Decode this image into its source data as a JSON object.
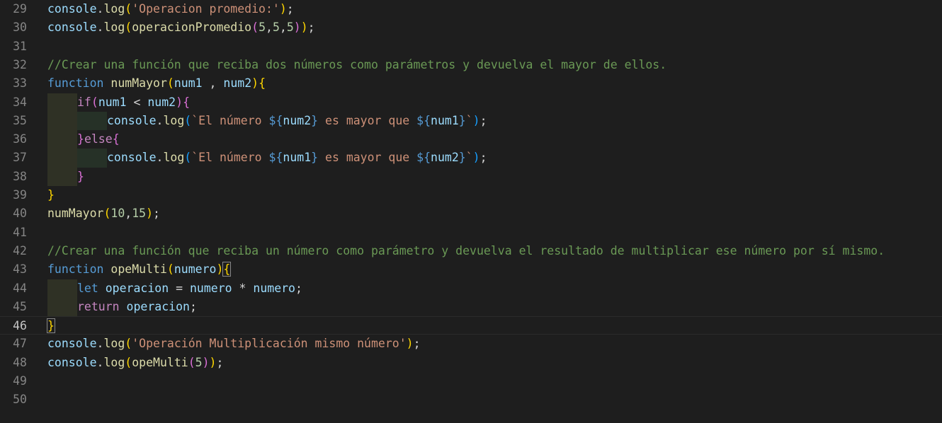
{
  "editor": {
    "lines": [
      {
        "n": "29",
        "tokens": [
          [
            "t-id",
            "console"
          ],
          [
            "t-p",
            "."
          ],
          [
            "t-fn",
            "log"
          ],
          [
            "b1",
            "("
          ],
          [
            "t-str",
            "'Operacion promedio:'"
          ],
          [
            "b1",
            ")"
          ],
          [
            "t-p",
            ";"
          ]
        ]
      },
      {
        "n": "30",
        "tokens": [
          [
            "t-id",
            "console"
          ],
          [
            "t-p",
            "."
          ],
          [
            "t-fn",
            "log"
          ],
          [
            "b1",
            "("
          ],
          [
            "t-fn",
            "operacionPromedio"
          ],
          [
            "b2",
            "("
          ],
          [
            "t-num",
            "5"
          ],
          [
            "t-p",
            ","
          ],
          [
            "t-num",
            "5"
          ],
          [
            "t-p",
            ","
          ],
          [
            "t-num",
            "5"
          ],
          [
            "b2",
            ")"
          ],
          [
            "b1",
            ")"
          ],
          [
            "t-p",
            ";"
          ]
        ]
      },
      {
        "n": "31",
        "tokens": []
      },
      {
        "n": "32",
        "tokens": [
          [
            "t-cm",
            "//Crear una función que reciba dos números como parámetros y devuelva el mayor de ellos."
          ]
        ]
      },
      {
        "n": "33",
        "tokens": [
          [
            "t-kw",
            "function"
          ],
          [
            "t-p",
            " "
          ],
          [
            "t-fn",
            "numMayor"
          ],
          [
            "b1",
            "("
          ],
          [
            "t-id",
            "num1"
          ],
          [
            "t-p",
            " , "
          ],
          [
            "t-id",
            "num2"
          ],
          [
            "b1",
            ")"
          ],
          [
            "b1",
            "{"
          ]
        ]
      },
      {
        "n": "34",
        "indent": 1,
        "tokens": [
          [
            "t-ctl",
            "if"
          ],
          [
            "b2",
            "("
          ],
          [
            "t-id",
            "num1"
          ],
          [
            "t-p",
            " < "
          ],
          [
            "t-id",
            "num2"
          ],
          [
            "b2",
            ")"
          ],
          [
            "b2",
            "{"
          ]
        ]
      },
      {
        "n": "35",
        "indent": 2,
        "tokens": [
          [
            "t-id",
            "console"
          ],
          [
            "t-p",
            "."
          ],
          [
            "t-fn",
            "log"
          ],
          [
            "b3",
            "("
          ],
          [
            "t-str",
            "`El número "
          ],
          [
            "t-tpl",
            "${"
          ],
          [
            "t-id",
            "num2"
          ],
          [
            "t-tpl",
            "}"
          ],
          [
            "t-str",
            " es mayor que "
          ],
          [
            "t-tpl",
            "${"
          ],
          [
            "t-id",
            "num1"
          ],
          [
            "t-tpl",
            "}"
          ],
          [
            "t-str",
            "`"
          ],
          [
            "b3",
            ")"
          ],
          [
            "t-p",
            ";"
          ]
        ]
      },
      {
        "n": "36",
        "indent": 1,
        "tokens": [
          [
            "b2",
            "}"
          ],
          [
            "t-ctl",
            "else"
          ],
          [
            "b2",
            "{"
          ]
        ]
      },
      {
        "n": "37",
        "indent": 2,
        "tokens": [
          [
            "t-id",
            "console"
          ],
          [
            "t-p",
            "."
          ],
          [
            "t-fn",
            "log"
          ],
          [
            "b3",
            "("
          ],
          [
            "t-str",
            "`El número "
          ],
          [
            "t-tpl",
            "${"
          ],
          [
            "t-id",
            "num1"
          ],
          [
            "t-tpl",
            "}"
          ],
          [
            "t-str",
            " es mayor que "
          ],
          [
            "t-tpl",
            "${"
          ],
          [
            "t-id",
            "num2"
          ],
          [
            "t-tpl",
            "}"
          ],
          [
            "t-str",
            "`"
          ],
          [
            "b3",
            ")"
          ],
          [
            "t-p",
            ";"
          ]
        ]
      },
      {
        "n": "38",
        "indent": 1,
        "tokens": [
          [
            "b2",
            "}"
          ]
        ]
      },
      {
        "n": "39",
        "tokens": [
          [
            "b1",
            "}"
          ]
        ]
      },
      {
        "n": "40",
        "tokens": [
          [
            "t-fn",
            "numMayor"
          ],
          [
            "b1",
            "("
          ],
          [
            "t-num",
            "10"
          ],
          [
            "t-p",
            ","
          ],
          [
            "t-num",
            "15"
          ],
          [
            "b1",
            ")"
          ],
          [
            "t-p",
            ";"
          ]
        ]
      },
      {
        "n": "41",
        "tokens": []
      },
      {
        "n": "42",
        "tokens": [
          [
            "t-cm",
            "//Crear una función que reciba un número como parámetro y devuelva el resultado de multiplicar ese número por sí mismo."
          ]
        ]
      },
      {
        "n": "43",
        "tokens": [
          [
            "t-kw",
            "function"
          ],
          [
            "t-p",
            " "
          ],
          [
            "t-fn",
            "opeMulti"
          ],
          [
            "b1",
            "("
          ],
          [
            "t-id",
            "numero"
          ],
          [
            "b1",
            ")"
          ],
          [
            "b1 match",
            "{"
          ]
        ]
      },
      {
        "n": "44",
        "indent": 1,
        "tokens": [
          [
            "t-kw",
            "let"
          ],
          [
            "t-p",
            " "
          ],
          [
            "t-id",
            "operacion"
          ],
          [
            "t-p",
            " = "
          ],
          [
            "t-id",
            "numero"
          ],
          [
            "t-p",
            " * "
          ],
          [
            "t-id",
            "numero"
          ],
          [
            "t-p",
            ";"
          ]
        ]
      },
      {
        "n": "45",
        "indent": 1,
        "tokens": [
          [
            "t-ctl",
            "return"
          ],
          [
            "t-p",
            " "
          ],
          [
            "t-id",
            "operacion"
          ],
          [
            "t-p",
            ";"
          ]
        ]
      },
      {
        "n": "46",
        "current": true,
        "tokens": [
          [
            "b1 match",
            "}"
          ]
        ]
      },
      {
        "n": "47",
        "tokens": [
          [
            "t-id",
            "console"
          ],
          [
            "t-p",
            "."
          ],
          [
            "t-fn",
            "log"
          ],
          [
            "b1",
            "("
          ],
          [
            "t-str",
            "'Operación Multiplicación mismo número'"
          ],
          [
            "b1",
            ")"
          ],
          [
            "t-p",
            ";"
          ]
        ]
      },
      {
        "n": "48",
        "tokens": [
          [
            "t-id",
            "console"
          ],
          [
            "t-p",
            "."
          ],
          [
            "t-fn",
            "log"
          ],
          [
            "b1",
            "("
          ],
          [
            "t-fn",
            "opeMulti"
          ],
          [
            "b2",
            "("
          ],
          [
            "t-num",
            "5"
          ],
          [
            "b2",
            ")"
          ],
          [
            "b1",
            ")"
          ],
          [
            "t-p",
            ";"
          ]
        ]
      },
      {
        "n": "49",
        "tokens": []
      },
      {
        "n": "50",
        "tokens": []
      }
    ]
  }
}
